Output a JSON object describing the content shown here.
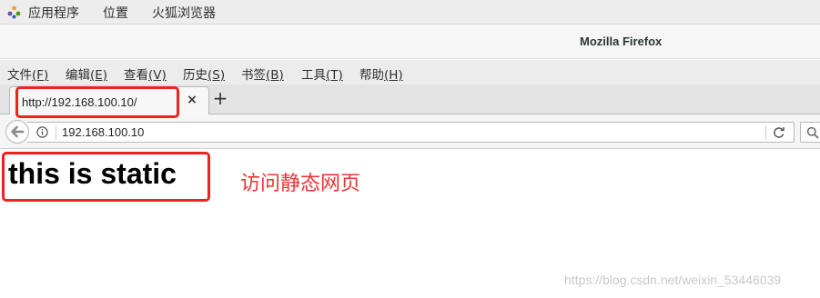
{
  "topbar": {
    "app_icon": "apps-icon",
    "items": [
      "应用程序",
      "位置",
      "火狐浏览器"
    ]
  },
  "window": {
    "title": "Mozilla Firefox"
  },
  "menubar": {
    "items": [
      {
        "label": "文件",
        "accel": "(F)"
      },
      {
        "label": "编辑",
        "accel": "(E)"
      },
      {
        "label": "查看",
        "accel": "(V)"
      },
      {
        "label": "历史",
        "accel": "(S)"
      },
      {
        "label": "书签",
        "accel": "(B)"
      },
      {
        "label": "工具",
        "accel": "(T)"
      },
      {
        "label": "帮助",
        "accel": "(H)"
      }
    ]
  },
  "tabs": [
    {
      "title": "http://192.168.100.10/",
      "close_glyph": "×"
    }
  ],
  "new_tab_glyph": "+",
  "navbar": {
    "back_icon": "back-arrow-icon",
    "info_icon": "info-icon",
    "url": "192.168.100.10",
    "reload_icon": "reload-icon",
    "search_icon": "search-icon"
  },
  "page": {
    "heading": "this is static",
    "annotation": "访问静态网页",
    "watermark": "https://blog.csdn.net/weixin_53446039"
  },
  "colors": {
    "highlight": "#ee2222",
    "annotation_text": "#ee3333"
  }
}
